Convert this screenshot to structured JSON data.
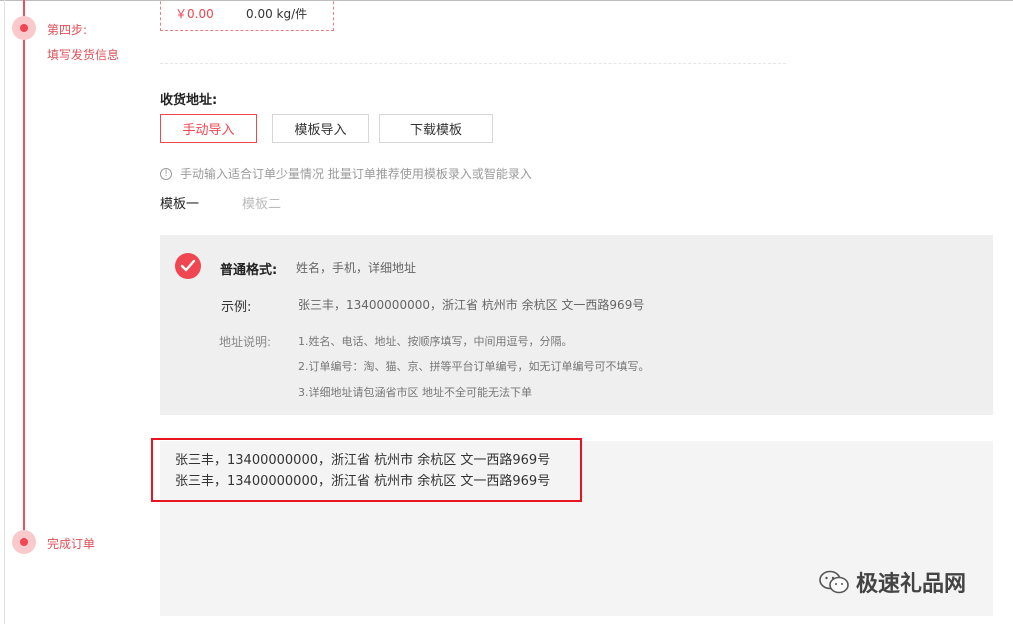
{
  "steps": {
    "step4_title": "第四步:",
    "step4_sub": "填写发货信息",
    "done_label": "完成订单"
  },
  "price_box": {
    "price": "￥0.00",
    "weight": "0.00 kg/件"
  },
  "address": {
    "title": "收货地址:",
    "buttons": {
      "manual": "手动导入",
      "template": "模板导入",
      "download": "下载模板"
    },
    "tip": "手动输入适合订单少量情况 批量订单推荐使用模板录入或智能录入",
    "tabs": [
      "模板一",
      "模板二"
    ]
  },
  "format_panel": {
    "format_label": "普通格式:",
    "format_value": "姓名，手机，详细地址",
    "example_label": "示例:",
    "example_value": "张三丰，13400000000，浙江省 杭州市 余杭区 文一西路969号",
    "notes_label": "地址说明:",
    "notes": [
      "1.姓名、电话、地址、按顺序填写，中间用逗号，分隔。",
      "2.订单编号：淘、猫、京、拼等平台订单编号，如无订单编号可不填写。",
      "3.详细地址请包涵省市区 地址不全可能无法下单"
    ]
  },
  "input_area": {
    "lines": [
      "张三丰，13400000000，浙江省 杭州市 余杭区 文一西路969号",
      "张三丰，13400000000，浙江省 杭州市 余杭区 文一西路969号"
    ]
  },
  "watermark": {
    "text": "极速礼品网"
  },
  "colors": {
    "accent": "#ef4651",
    "highlight": "#e8141f",
    "panel_bg": "#efefef"
  }
}
